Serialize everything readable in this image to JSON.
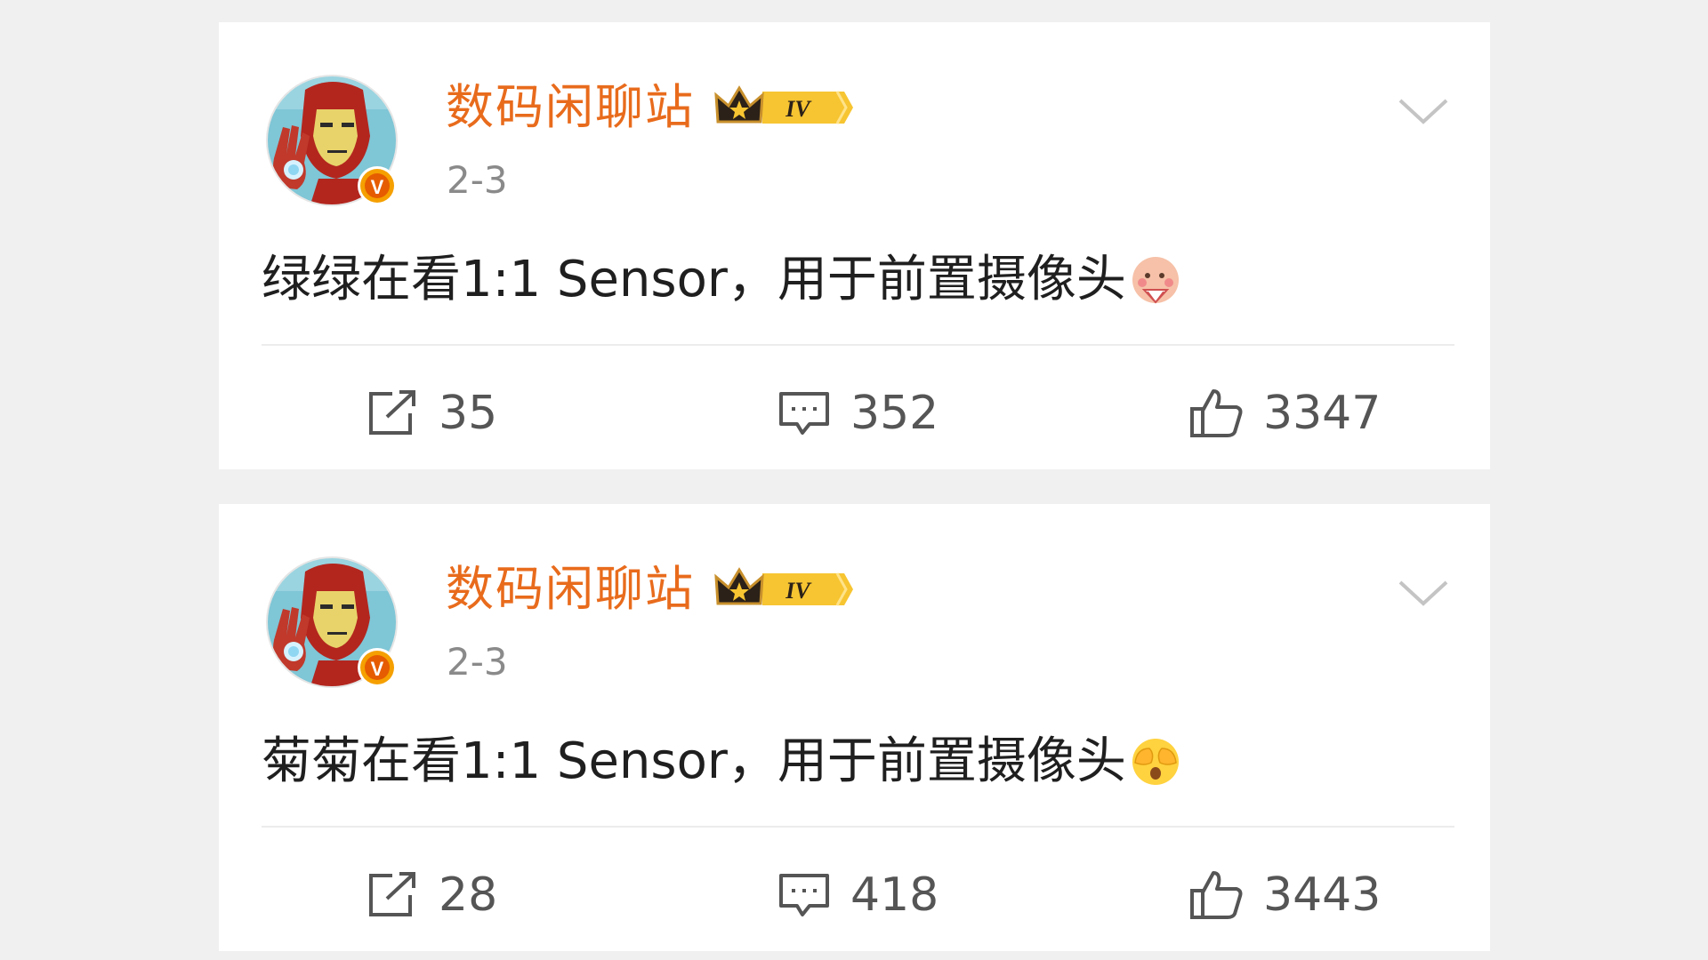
{
  "posts": [
    {
      "user_name": "数码闲聊站",
      "level_badge": "IV",
      "verified_badge": "V",
      "date": "2-3",
      "text": "绿绿在看1:1 Sensor，用于前置摄像头",
      "emoji": "shy-fan-emoji",
      "reposts": "35",
      "comments": "352",
      "likes": "3347"
    },
    {
      "user_name": "数码闲聊站",
      "level_badge": "IV",
      "verified_badge": "V",
      "date": "2-3",
      "text": "菊菊在看1:1 Sensor，用于前置摄像头",
      "emoji": "cover-eyes-emoji",
      "reposts": "28",
      "comments": "418",
      "likes": "3443"
    }
  ],
  "colors": {
    "username": "#e86b1c",
    "date": "#8a8a8a",
    "text": "#1f1f1f",
    "counts": "#555555",
    "background": "#f0f0f0",
    "card": "#ffffff",
    "verified": "#f5a000",
    "badge_gold": "#f7c531"
  },
  "icons": {
    "repost": "repost-icon",
    "comment": "comment-icon",
    "like": "thumbs-up-icon",
    "menu": "chevron-down-icon",
    "avatar": "iron-man-avatar",
    "crown": "crown-icon"
  }
}
